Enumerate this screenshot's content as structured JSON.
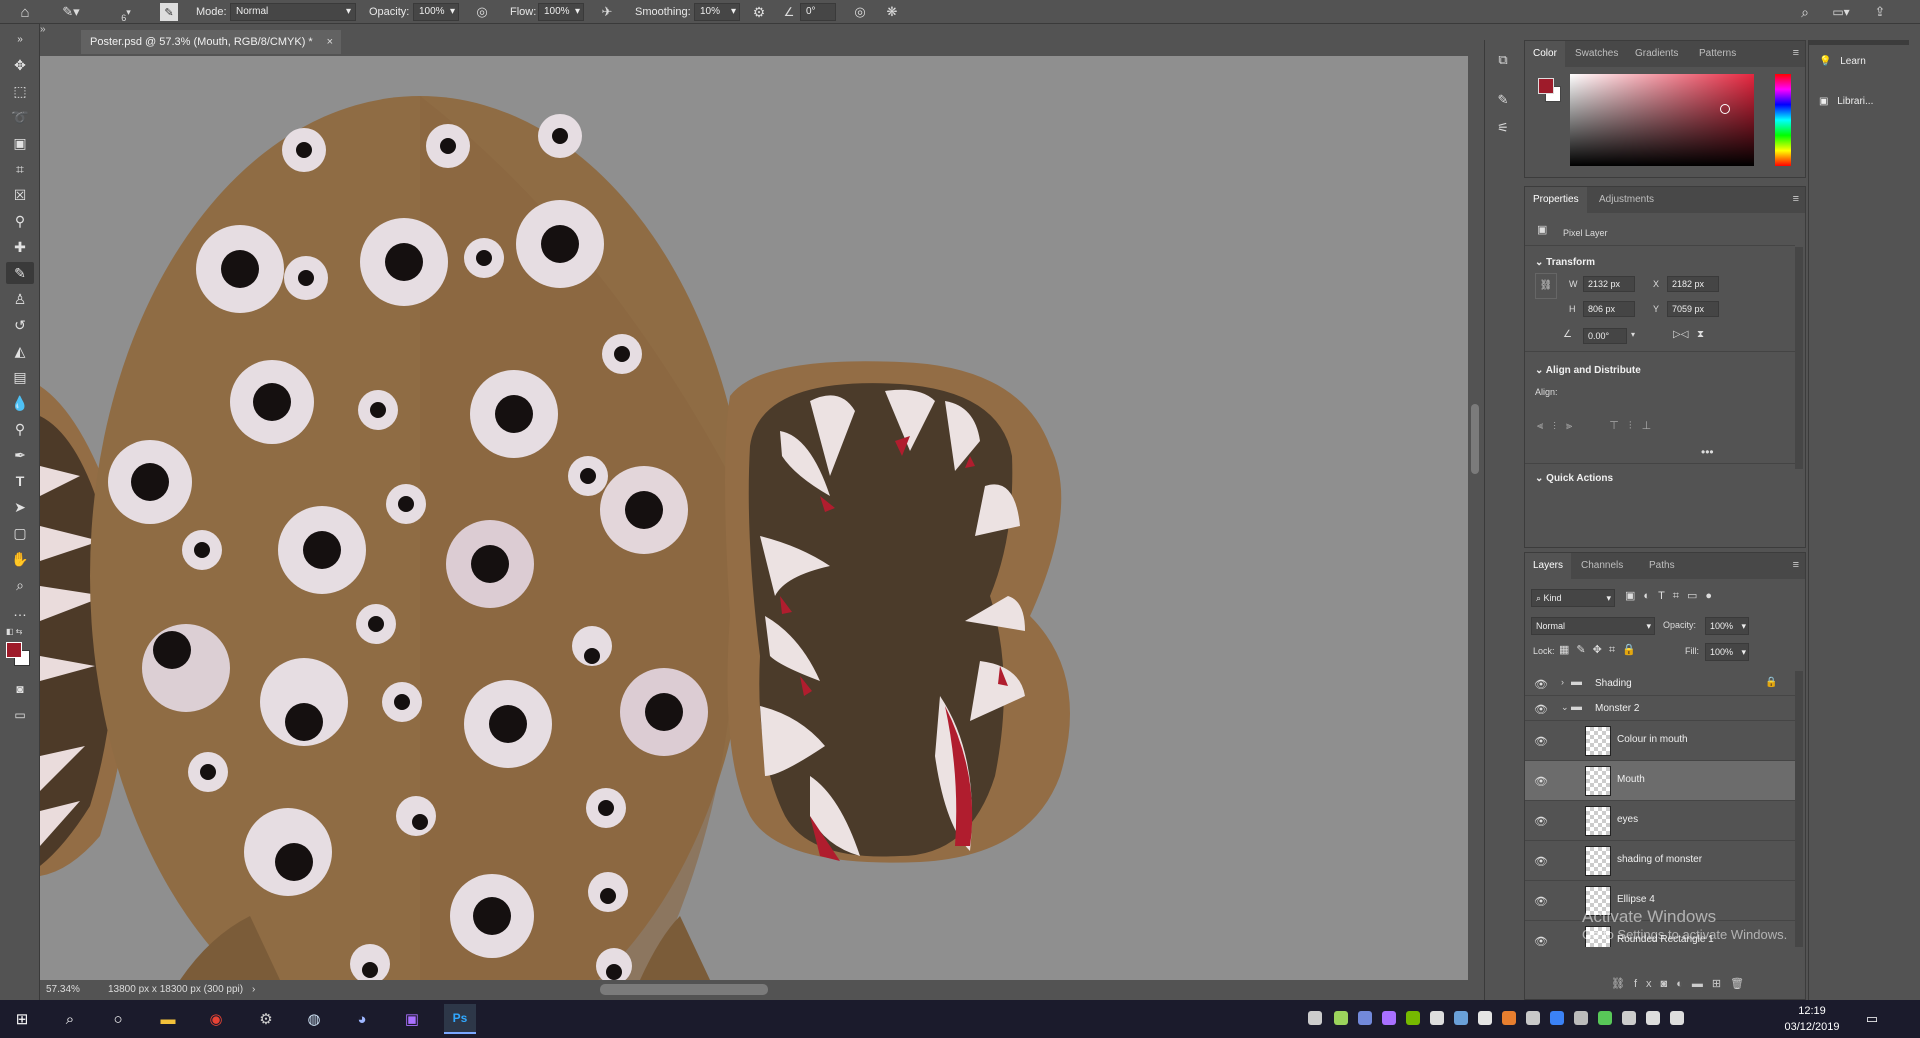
{
  "options_bar": {
    "mode_label": "Mode:",
    "mode_value": "Normal",
    "opacity_label": "Opacity:",
    "opacity_value": "100%",
    "flow_label": "Flow:",
    "flow_value": "100%",
    "smoothing_label": "Smoothing:",
    "smoothing_value": "10%",
    "angle_value": "0°",
    "brush_size": "6"
  },
  "document": {
    "tab_title": "Poster.psd @ 57.3% (Mouth, RGB/8/CMYK) *",
    "zoom": "57.34%",
    "doc_info": "13800 px x 18300 px (300 ppi)"
  },
  "color_panel": {
    "tabs": [
      "Color",
      "Swatches",
      "Gradients",
      "Patterns"
    ],
    "foreground": "#9e1b2a",
    "background": "#ffffff"
  },
  "properties_panel": {
    "tabs": [
      "Properties",
      "Adjustments"
    ],
    "kind": "Pixel Layer",
    "transform_title": "Transform",
    "w_label": "W",
    "w_value": "2132 px",
    "h_label": "H",
    "h_value": "806 px",
    "x_label": "X",
    "x_value": "2182 px",
    "y_label": "Y",
    "y_value": "7059 px",
    "angle": "0.00°",
    "align_title": "Align and Distribute",
    "align_label": "Align:",
    "quick_actions": "Quick Actions"
  },
  "layers_panel": {
    "tabs": [
      "Layers",
      "Channels",
      "Paths"
    ],
    "filter": "Kind",
    "blend_mode": "Normal",
    "opacity_label": "Opacity:",
    "opacity_value": "100%",
    "lock_label": "Lock:",
    "fill_label": "Fill:",
    "fill_value": "100%",
    "groups": [
      {
        "name": "Shading"
      },
      {
        "name": "Monster 2"
      }
    ],
    "layers": [
      {
        "name": "Colour in mouth"
      },
      {
        "name": "Mouth"
      },
      {
        "name": "eyes"
      },
      {
        "name": "shading of monster"
      },
      {
        "name": "Ellipse 4"
      },
      {
        "name": "Rounded Rectangle 1"
      }
    ]
  },
  "learn_panel": {
    "items": [
      "Learn",
      "Librari..."
    ]
  },
  "watermark": {
    "line1": "Activate Windows",
    "line2": "Go to Settings to activate Windows."
  },
  "taskbar": {
    "time": "12:19",
    "date": "03/12/2019"
  }
}
